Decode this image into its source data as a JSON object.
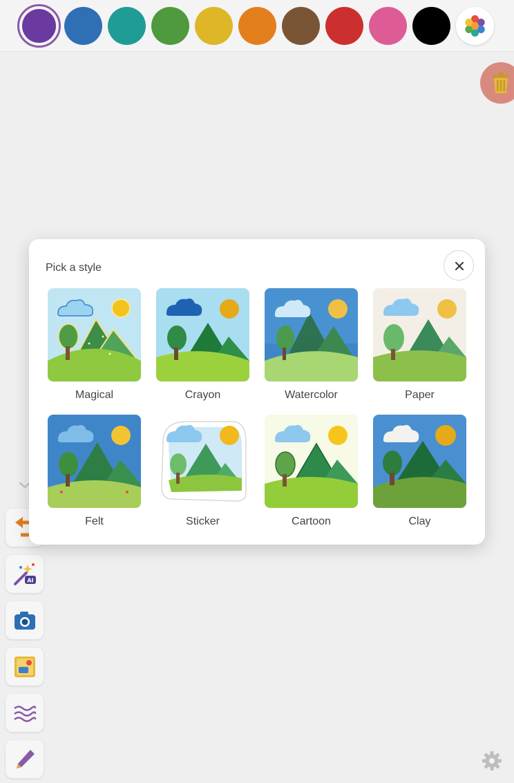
{
  "palette": {
    "colors": [
      {
        "name": "purple",
        "hex": "#6a3aa0",
        "selected": true
      },
      {
        "name": "blue",
        "hex": "#2f6fb5"
      },
      {
        "name": "teal",
        "hex": "#1f9c95"
      },
      {
        "name": "green",
        "hex": "#4f9a3e"
      },
      {
        "name": "yellow",
        "hex": "#ddb727"
      },
      {
        "name": "orange",
        "hex": "#e27f1c"
      },
      {
        "name": "brown",
        "hex": "#7a5535"
      },
      {
        "name": "red",
        "hex": "#cc2f2f"
      },
      {
        "name": "pink",
        "hex": "#dd5c95"
      },
      {
        "name": "black",
        "hex": "#000000"
      }
    ],
    "more_colors_icon": "hexagon-palette-icon"
  },
  "toolbar": {
    "trash_icon": "trash-icon",
    "collapse_icon": "chevron-down-icon",
    "tools": [
      {
        "name": "undo",
        "icon": "undo-arrow-icon"
      },
      {
        "name": "ai-magic",
        "icon": "ai-magic-wand-icon"
      },
      {
        "name": "camera",
        "icon": "camera-icon"
      },
      {
        "name": "sticker",
        "icon": "sticker-image-icon"
      },
      {
        "name": "brush-style",
        "icon": "wave-lines-icon"
      },
      {
        "name": "pen",
        "icon": "pen-icon"
      }
    ],
    "settings_icon": "gear-icon"
  },
  "style_picker": {
    "title": "Pick a style",
    "close_icon": "close-icon",
    "styles": [
      {
        "label": "Magical"
      },
      {
        "label": "Crayon"
      },
      {
        "label": "Watercolor"
      },
      {
        "label": "Paper"
      },
      {
        "label": "Felt"
      },
      {
        "label": "Sticker"
      },
      {
        "label": "Cartoon"
      },
      {
        "label": "Clay"
      }
    ]
  }
}
